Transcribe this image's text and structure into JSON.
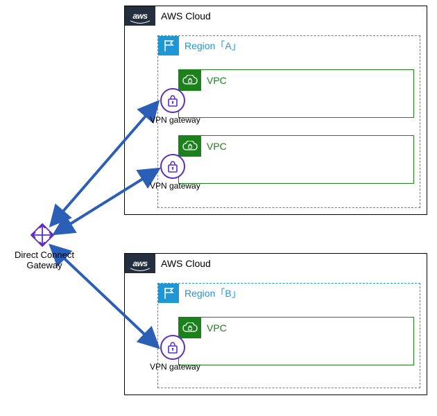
{
  "gateway": {
    "label": "Direct Connect\nGateway"
  },
  "clouds": [
    {
      "label": "AWS Cloud",
      "region": {
        "label": "Region「A」"
      },
      "vpcs": [
        {
          "label": "VPC",
          "vpn_label": "VPN gateway"
        },
        {
          "label": "VPC",
          "vpn_label": "VPN gateway"
        }
      ]
    },
    {
      "label": "AWS Cloud",
      "region": {
        "label": "Region「B」"
      },
      "vpcs": [
        {
          "label": "VPC",
          "vpn_label": "VPN gateway"
        }
      ]
    }
  ],
  "colors": {
    "region": "#2196d4",
    "vpc": "#1b811b",
    "vpn": "#5a2ec6",
    "arrow": "#2b5fb7",
    "aws_bg": "#232f3e"
  }
}
